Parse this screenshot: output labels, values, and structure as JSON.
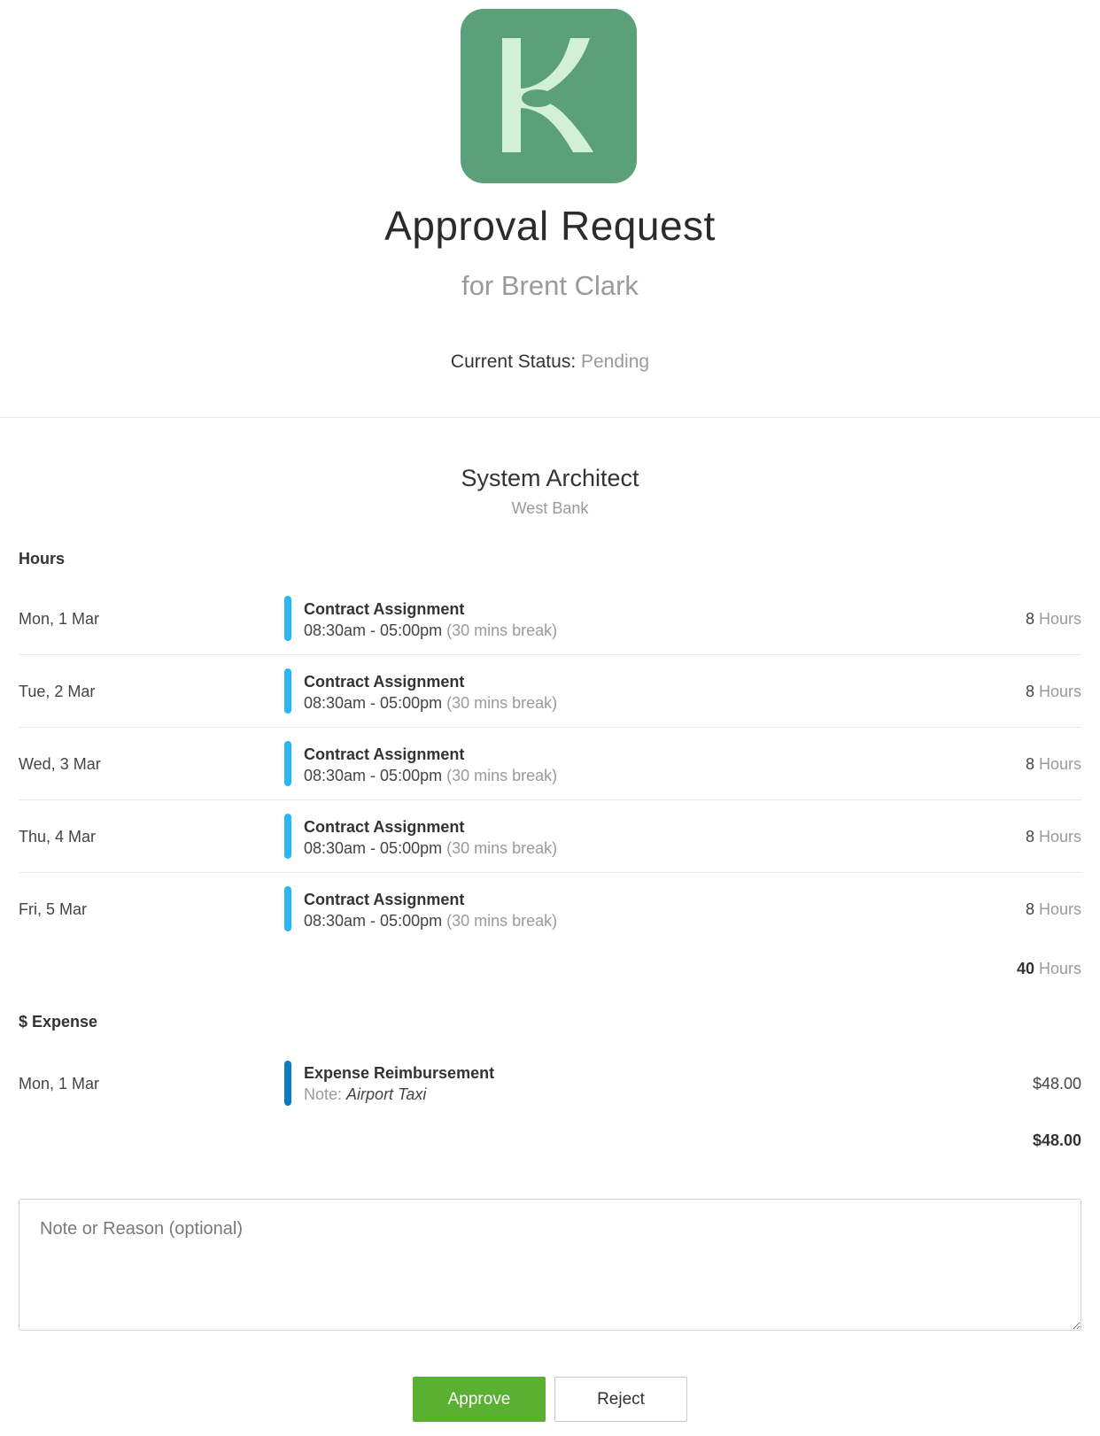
{
  "header": {
    "logo_icon": "k-logo-icon",
    "logo_color": "#5ba078",
    "title": "Approval Request",
    "subtitle": "for Brent Clark",
    "status_label": "Current Status:",
    "status_value": "Pending"
  },
  "role": {
    "title": "System Architect",
    "location": "West Bank"
  },
  "hours": {
    "label": "Hours",
    "bar_color": "#29b6f6",
    "rows": [
      {
        "date": "Mon, 1 Mar",
        "name": "Contract Assignment",
        "time": "08:30am - 05:00pm",
        "break": "(30 mins break)",
        "hours": "8",
        "unit": "Hours"
      },
      {
        "date": "Tue, 2 Mar",
        "name": "Contract Assignment",
        "time": "08:30am - 05:00pm",
        "break": "(30 mins break)",
        "hours": "8",
        "unit": "Hours"
      },
      {
        "date": "Wed, 3 Mar",
        "name": "Contract Assignment",
        "time": "08:30am - 05:00pm",
        "break": "(30 mins break)",
        "hours": "8",
        "unit": "Hours"
      },
      {
        "date": "Thu, 4 Mar",
        "name": "Contract Assignment",
        "time": "08:30am - 05:00pm",
        "break": "(30 mins break)",
        "hours": "8",
        "unit": "Hours"
      },
      {
        "date": "Fri, 5 Mar",
        "name": "Contract Assignment",
        "time": "08:30am - 05:00pm",
        "break": "(30 mins break)",
        "hours": "8",
        "unit": "Hours"
      }
    ],
    "total": "40",
    "total_unit": "Hours"
  },
  "expense": {
    "label": "$ Expense",
    "bar_color": "#0a7cc2",
    "rows": [
      {
        "date": "Mon, 1 Mar",
        "name": "Expense Reimbursement",
        "note_label": "Note:",
        "note_value": "Airport Taxi",
        "amount": "$48.00"
      }
    ],
    "total": "$48.00"
  },
  "note_field": {
    "placeholder": "Note or Reason (optional)",
    "value": ""
  },
  "actions": {
    "approve_label": "Approve",
    "reject_label": "Reject",
    "approve_color": "#5ab030"
  }
}
